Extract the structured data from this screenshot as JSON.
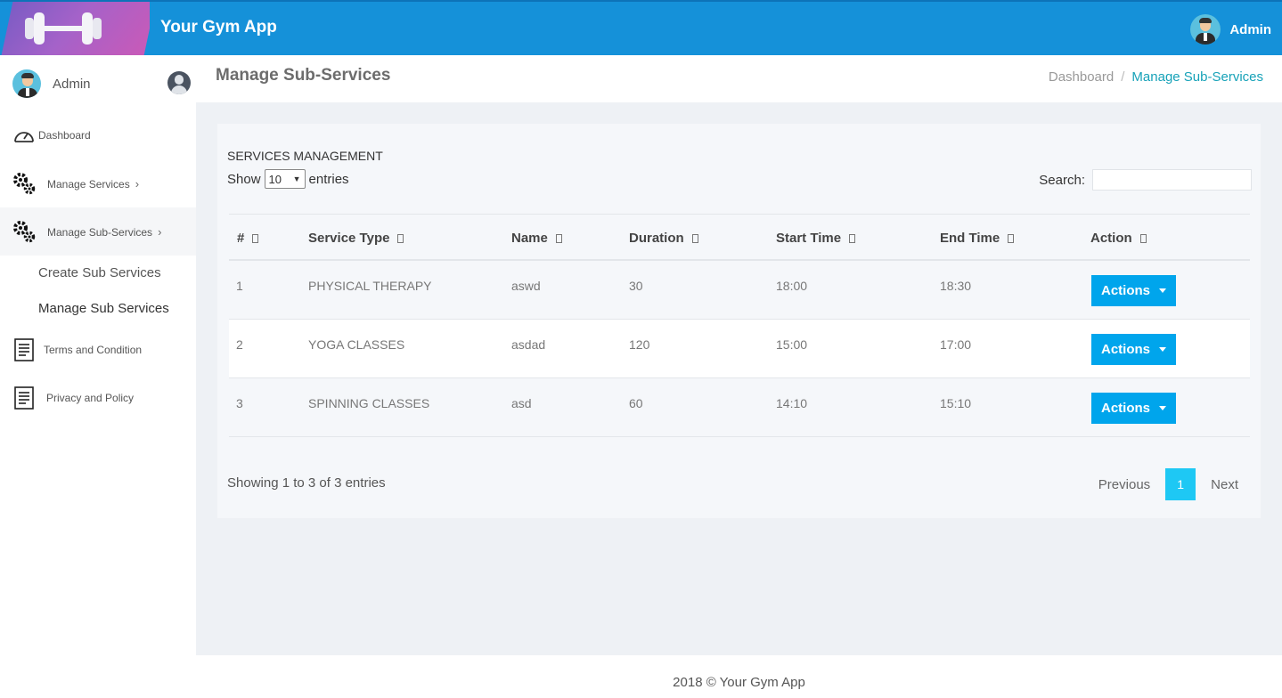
{
  "app": {
    "name": "Your Gym App",
    "top_user": "Admin"
  },
  "sidebar": {
    "user_name": "Admin",
    "items": [
      {
        "label": "Dashboard",
        "icon": "dashboard-icon"
      },
      {
        "label": "Manage Services",
        "icon": "gears-icon"
      },
      {
        "label": "Manage Sub-Services",
        "icon": "gears-icon"
      },
      {
        "label": "Terms and Condition",
        "icon": "document-icon"
      },
      {
        "label": "Privacy and Policy",
        "icon": "document-icon"
      }
    ],
    "sub_items": [
      {
        "label": "Create Sub Services"
      },
      {
        "label": "Manage Sub Services"
      }
    ]
  },
  "header": {
    "title": "Manage Sub-Services",
    "breadcrumb": [
      "Dashboard",
      "Manage Sub-Services"
    ],
    "breadcrumb_separator": "/"
  },
  "card": {
    "title": "SERVICES MANAGEMENT",
    "show_label": "Show",
    "entries_label": "entries",
    "page_length": "10",
    "search_label": "Search:",
    "search_value": ""
  },
  "table": {
    "headers": [
      "#",
      "Service Type",
      "Name",
      "Duration",
      "Start Time",
      "End Time",
      "Action"
    ],
    "rows": [
      {
        "num": "1",
        "service_type": "PHYSICAL THERAPY",
        "name": "aswd",
        "duration": "30",
        "start": "18:00",
        "end": "18:30",
        "action": "Actions"
      },
      {
        "num": "2",
        "service_type": "YOGA CLASSES",
        "name": "asdad",
        "duration": "120",
        "start": "15:00",
        "end": "17:00",
        "action": "Actions"
      },
      {
        "num": "3",
        "service_type": "SPINNING CLASSES",
        "name": "asd",
        "duration": "60",
        "start": "14:10",
        "end": "15:10",
        "action": "Actions"
      }
    ]
  },
  "pagination": {
    "info": "Showing 1 to 3 of 3 entries",
    "previous": "Previous",
    "current": "1",
    "next": "Next"
  },
  "footer": {
    "text": "2018 © Your Gym App"
  },
  "colors": {
    "topbar": "#1591d9",
    "accent": "#17a2b8",
    "button": "#00a5ec",
    "page_active": "#1ec8f4"
  }
}
